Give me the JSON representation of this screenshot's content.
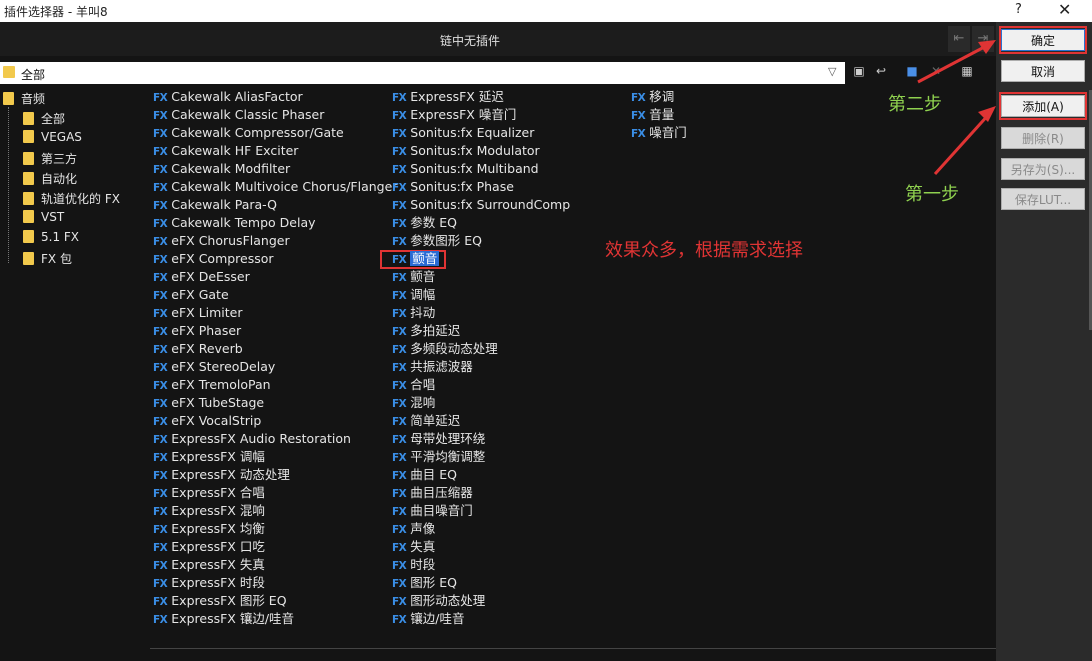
{
  "window": {
    "title": "插件选择器 - 羊叫8",
    "help_label": "?",
    "close_label": "✕"
  },
  "chain": {
    "status": "链中无插件",
    "nav_left_label": "⇤",
    "nav_right_label": "⇥"
  },
  "path": {
    "current": "全部"
  },
  "buttons": {
    "ok": "确定",
    "cancel": "取消",
    "add": "添加(A)",
    "remove": "删除(R)",
    "save_as": "另存为(S)...",
    "save_lut": "保存LUT..."
  },
  "tree": [
    "音频",
    "全部",
    "VEGAS",
    "第三方",
    "自动化",
    "轨道优化的 FX",
    "VST",
    "5.1 FX",
    "FX 包"
  ],
  "fx_badge": "FX",
  "plugins": {
    "col1": [
      "Cakewalk AliasFactor",
      "Cakewalk Classic Phaser",
      "Cakewalk Compressor/Gate",
      "Cakewalk HF Exciter",
      "Cakewalk Modfilter",
      "Cakewalk Multivoice Chorus/Flanger",
      "Cakewalk Para-Q",
      "Cakewalk Tempo Delay",
      "eFX ChorusFlanger",
      "eFX Compressor",
      "eFX DeEsser",
      "eFX Gate",
      "eFX Limiter",
      "eFX Phaser",
      "eFX Reverb",
      "eFX StereoDelay",
      "eFX TremoloPan",
      "eFX TubeStage",
      "eFX VocalStrip",
      "ExpressFX Audio Restoration",
      "ExpressFX 调幅",
      "ExpressFX 动态处理",
      "ExpressFX 合唱",
      "ExpressFX 混响",
      "ExpressFX 均衡",
      "ExpressFX 口吃",
      "ExpressFX 失真",
      "ExpressFX 时段",
      "ExpressFX 图形 EQ",
      "ExpressFX 镶边/哇音"
    ],
    "col2": [
      "ExpressFX 延迟",
      "ExpressFX 噪音门",
      "Sonitus:fx Equalizer",
      "Sonitus:fx Modulator",
      "Sonitus:fx Multiband",
      "Sonitus:fx Phase",
      "Sonitus:fx SurroundComp",
      "参数 EQ",
      "参数图形 EQ",
      "颤音",
      "颤音",
      "调幅",
      "抖动",
      "多拍延迟",
      "多频段动态处理",
      "共振滤波器",
      "合唱",
      "混响",
      "简单延迟",
      "母带处理环绕",
      "平滑均衡调整",
      "曲目 EQ",
      "曲目压缩器",
      "曲目噪音门",
      "声像",
      "失真",
      "时段",
      "图形 EQ",
      "图形动态处理",
      "镶边/哇音"
    ],
    "col3": [
      "移调",
      "音量",
      "噪音门"
    ],
    "selected_col": 2,
    "selected_index": 9
  },
  "annotations": {
    "step1": "第一步",
    "step2": "第二步",
    "note": "效果众多，根据需求选择",
    "green": "#8fd14f",
    "red": "#e03434"
  }
}
